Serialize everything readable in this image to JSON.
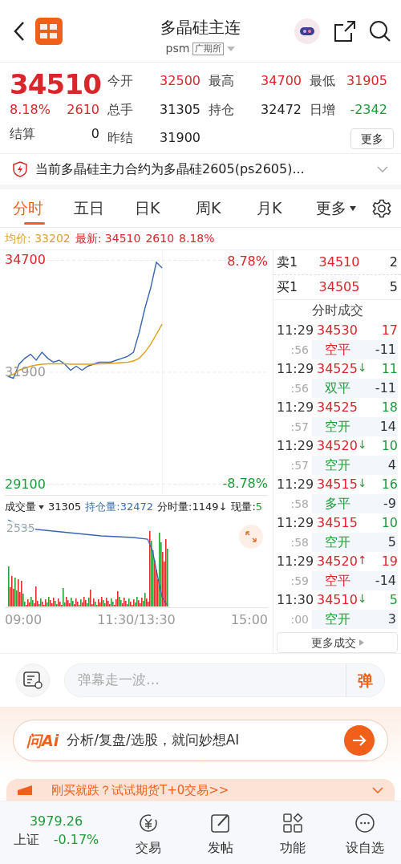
{
  "header": {
    "title": "多晶硅主连",
    "code": "psm",
    "exchange": "广期所"
  },
  "quote": {
    "price": "34510",
    "change_pct": "8.18%",
    "change": "2610",
    "stats": [
      {
        "label": "今开",
        "value": "32500",
        "color": "#d9262b"
      },
      {
        "label": "最高",
        "value": "34700",
        "color": "#d9262b"
      },
      {
        "label": "最低",
        "value": "31905",
        "color": "#d9262b"
      },
      {
        "label": "总手",
        "value": "31305",
        "color": "#222222"
      },
      {
        "label": "持仓",
        "value": "32472",
        "color": "#222222"
      },
      {
        "label": "日增",
        "value": "-2342",
        "color": "#1f9a3a"
      }
    ],
    "settle_label": "结算",
    "settle_value": "0",
    "prev_label": "昨结",
    "prev_value": "31900",
    "more": "更多"
  },
  "notice": "当前多晶硅主力合约为多晶硅2605(ps2605)...",
  "tabs": [
    {
      "label": "分时",
      "selected": true
    },
    {
      "label": "五日",
      "selected": false
    },
    {
      "label": "日K",
      "selected": false
    },
    {
      "label": "周K",
      "selected": false
    },
    {
      "label": "月K",
      "selected": false
    }
  ],
  "tabs_more": "更多",
  "summary": {
    "avg_label": "均价:",
    "avg": "33202",
    "last_label": "最新:",
    "last": "34510",
    "change": "2610",
    "pct": "8.18%"
  },
  "chart": {
    "high_pct": "8.78%",
    "low_pct": "-8.78%",
    "chart_data": {
      "type": "line",
      "categories": [
        null,
        null,
        null,
        null,
        null,
        null,
        null,
        null,
        null,
        null,
        null,
        null,
        null,
        null,
        null,
        null,
        null,
        null,
        null,
        null,
        null,
        null,
        null,
        null,
        null,
        null,
        null,
        null,
        null,
        null,
        null,
        null,
        null,
        null,
        null,
        null,
        null,
        null,
        null,
        null,
        null,
        null,
        null,
        null,
        null,
        null
      ],
      "series": [
        {
          "color": "#3a66b0",
          "values": [
            31800,
            31750,
            32100,
            32250,
            32350,
            32200,
            32400,
            32250,
            32150,
            32200,
            32100,
            31950,
            32050,
            31950,
            32050,
            32100,
            32150,
            32150,
            32150,
            32200,
            32250,
            32300,
            32400,
            32900,
            33500,
            34000,
            34650,
            34510,
            null,
            null,
            null,
            null,
            null,
            null,
            null,
            null,
            null,
            null,
            null,
            null,
            null,
            null,
            null,
            null,
            null,
            null
          ]
        },
        {
          "color": "#e0a020",
          "values": [
            31800,
            31850,
            31950,
            32000,
            32050,
            32080,
            32100,
            32110,
            32110,
            32110,
            32110,
            32100,
            32100,
            32100,
            32100,
            32100,
            32110,
            32110,
            32120,
            32130,
            32140,
            32150,
            32180,
            32250,
            32400,
            32600,
            32850,
            33100,
            null,
            null,
            null,
            null,
            null,
            null,
            null,
            null,
            null,
            null,
            null,
            null,
            null,
            null,
            null,
            null,
            null,
            null
          ]
        }
      ],
      "ylim": [
        28850,
        34950
      ],
      "grid": true,
      "yticks": [
        {
          "value": 29100,
          "label": "29100"
        },
        {
          "value": 31900,
          "label": "31900"
        },
        {
          "value": 34700,
          "label": "34700"
        }
      ]
    }
  },
  "time_axis": [
    "09:00",
    "11:30/13:30",
    "15:00"
  ],
  "volume": {
    "selector": "成交量",
    "total": "31305",
    "oi_label": "持仓量:32472",
    "tick_label": "分时量:1149↓",
    "now_label": "现量:",
    "now": "5",
    "axis_value": "2535"
  },
  "book": [
    {
      "label": "卖1",
      "price": "34510",
      "qty": "2"
    },
    {
      "label": "买1",
      "price": "34505",
      "qty": "5"
    }
  ],
  "trades_title": "分时成交",
  "trades": [
    {
      "time": "11:29",
      "price": "34530",
      "qty": {
        "text": "17",
        "color": "#d9262b"
      },
      "sub_time": ":56",
      "action": {
        "text": "空平",
        "color": "#d9262b"
      },
      "change": "-11"
    },
    {
      "time": "11:29",
      "price": "34525",
      "arrow": {
        "text": "↓",
        "color": "#1f9a3a"
      },
      "qty": {
        "text": "11",
        "color": "#1f9a3a"
      },
      "sub_time": ":56",
      "action": {
        "text": "双平",
        "color": "#1f9a3a"
      },
      "change": "-11"
    },
    {
      "time": "11:29",
      "price": "34525",
      "qty": {
        "text": "18",
        "color": "#1f9a3a"
      },
      "sub_time": ":57",
      "action": {
        "text": "空开",
        "color": "#1f9a3a"
      },
      "change": "14"
    },
    {
      "time": "11:29",
      "price": "34520",
      "arrow": {
        "text": "↓",
        "color": "#1f9a3a"
      },
      "qty": {
        "text": "10",
        "color": "#1f9a3a"
      },
      "sub_time": ":57",
      "action": {
        "text": "空开",
        "color": "#1f9a3a"
      },
      "change": "4"
    },
    {
      "time": "11:29",
      "price": "34515",
      "arrow": {
        "text": "↓",
        "color": "#1f9a3a"
      },
      "qty": {
        "text": "16",
        "color": "#1f9a3a"
      },
      "sub_time": ":58",
      "action": {
        "text": "多平",
        "color": "#1f9a3a"
      },
      "change": "-9"
    },
    {
      "time": "11:29",
      "price": "34515",
      "qty": {
        "text": "10",
        "color": "#1f9a3a"
      },
      "sub_time": ":58",
      "action": {
        "text": "空开",
        "color": "#1f9a3a"
      },
      "change": "5"
    },
    {
      "time": "11:29",
      "price": "34520",
      "arrow": {
        "text": "↑",
        "color": "#d9262b"
      },
      "qty": {
        "text": "19",
        "color": "#d9262b"
      },
      "sub_time": ":59",
      "action": {
        "text": "空平",
        "color": "#d9262b"
      },
      "change": "-14"
    },
    {
      "time": "11:30",
      "price": "34510",
      "arrow": {
        "text": "↓",
        "color": "#1f9a3a"
      },
      "qty": {
        "text": "5",
        "color": "#1f9a3a"
      },
      "sub_time": ":00",
      "action": {
        "text": "空开",
        "color": "#1f9a3a"
      },
      "change": "3"
    }
  ],
  "more_trades": "更多成交",
  "danmu": {
    "placeholder": "弹幕走一波…",
    "button": "弹"
  },
  "ai": {
    "logo": "问Ai",
    "text": "分析/复盘/选股，就问妙想AI"
  },
  "promo": "刚买就跌？试试期货T+0交易>>",
  "bottom": {
    "index_value": "3979.26",
    "index_name": "上证",
    "index_change": "-0.17%",
    "items": [
      {
        "label": "交易",
        "kind": "trade"
      },
      {
        "label": "发帖",
        "kind": "post"
      },
      {
        "label": "功能",
        "kind": "apps"
      },
      {
        "label": "设自选",
        "kind": "more"
      }
    ]
  }
}
